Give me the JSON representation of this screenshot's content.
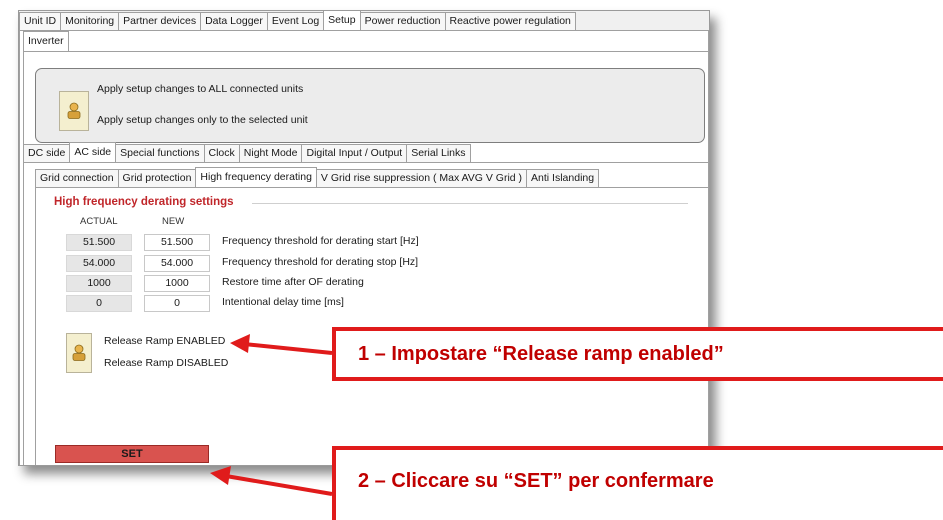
{
  "main_tabs": [
    {
      "label": "Unit ID",
      "active": false
    },
    {
      "label": "Monitoring",
      "active": false
    },
    {
      "label": "Partner devices",
      "active": false
    },
    {
      "label": "Data Logger",
      "active": false
    },
    {
      "label": "Event Log",
      "active": false
    },
    {
      "label": "Setup",
      "active": true
    },
    {
      "label": "Power reduction",
      "active": false
    },
    {
      "label": "Reactive power regulation",
      "active": false
    }
  ],
  "sub_tab": "Inverter",
  "apply": {
    "all_units": "Apply setup changes to ALL connected units",
    "selected_unit": "Apply setup changes only to the selected unit"
  },
  "section_tabs": [
    {
      "label": "DC side",
      "active": false
    },
    {
      "label": "AC side",
      "active": true
    },
    {
      "label": "Special functions",
      "active": false
    },
    {
      "label": "Clock",
      "active": false
    },
    {
      "label": "Night Mode",
      "active": false
    },
    {
      "label": "Digital Input / Output",
      "active": false
    },
    {
      "label": "Serial Links",
      "active": false
    }
  ],
  "ac_tabs": [
    {
      "label": "Grid connection",
      "active": false
    },
    {
      "label": "Grid protection",
      "active": false
    },
    {
      "label": "High frequency derating",
      "active": true
    },
    {
      "label": "V Grid rise suppression ( Max AVG V Grid )",
      "active": false
    },
    {
      "label": "Anti Islanding",
      "active": false
    }
  ],
  "settings": {
    "title": "High frequency derating settings",
    "col_actual": "ACTUAL",
    "col_new": "NEW",
    "rows": [
      {
        "actual": "51.500",
        "new": "51.500",
        "label": "Frequency threshold for derating start [Hz]"
      },
      {
        "actual": "54.000",
        "new": "54.000",
        "label": "Frequency threshold for derating stop [Hz]"
      },
      {
        "actual": "1000",
        "new": "1000",
        "label": "Restore time after OF derating"
      },
      {
        "actual": "0",
        "new": "0",
        "label": "Intentional delay time [ms]"
      }
    ]
  },
  "ramp": {
    "enabled": "Release Ramp ENABLED",
    "disabled": "Release Ramp DISABLED"
  },
  "set_button": "SET",
  "callouts": {
    "step1": "1 – Impostare “Release ramp enabled”",
    "step2": "2 – Cliccare su “SET” per confermare"
  },
  "colors": {
    "callout_red": "#e01b1b",
    "callout_text": "#c00000",
    "section_title": "#c0262a",
    "set_button": "#d9534f"
  }
}
